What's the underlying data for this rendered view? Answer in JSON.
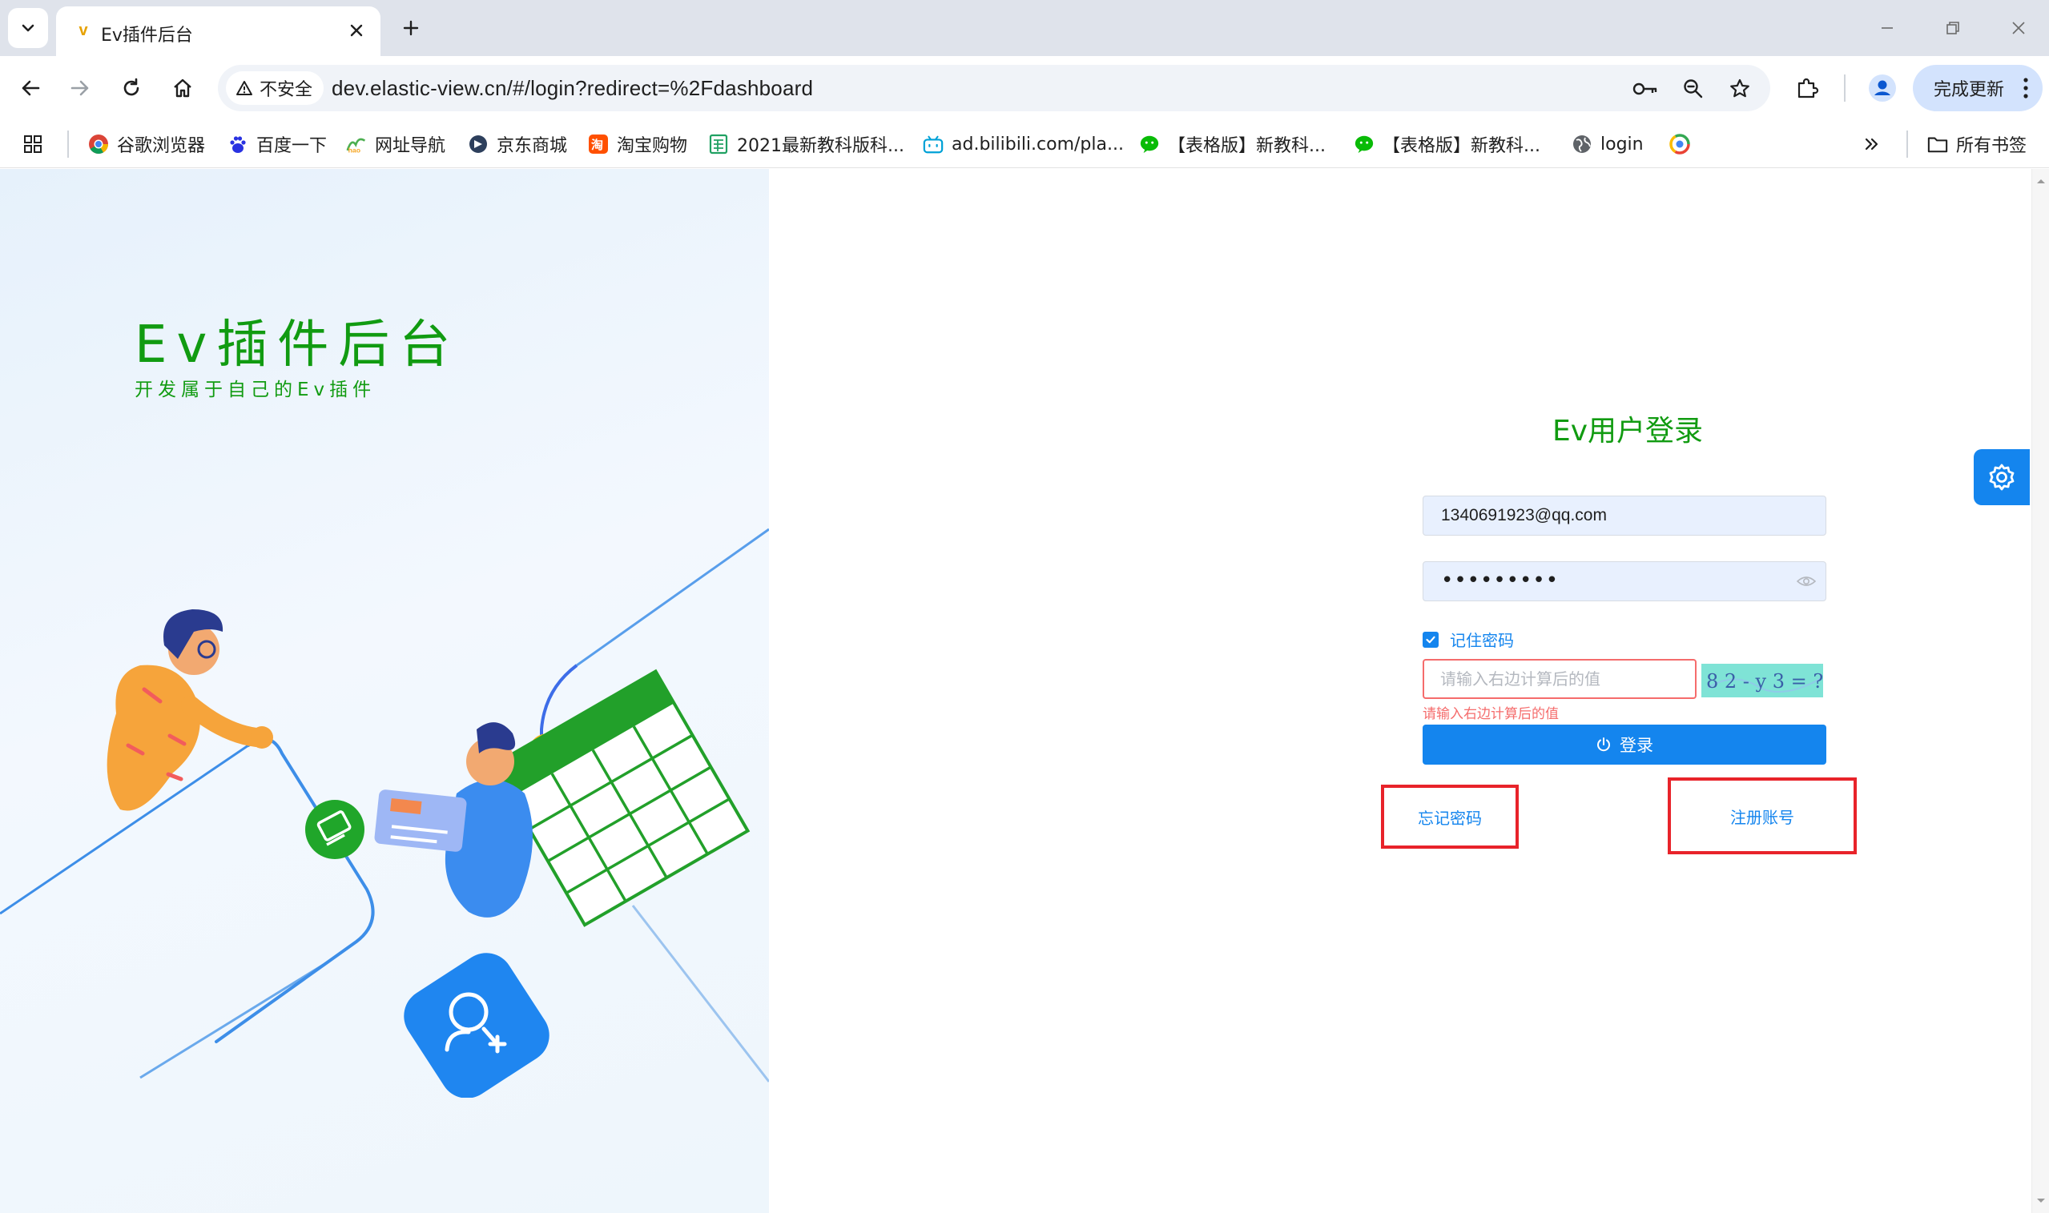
{
  "browser": {
    "tab_title": "Ev插件后台",
    "tab_favicon": "v",
    "not_secure_label": "不安全",
    "url": "dev.elastic-view.cn/#/login?redirect=%2Fdashboard",
    "update_button_label": "完成更新"
  },
  "bookmarks": {
    "items": [
      {
        "label": "谷歌浏览器",
        "icon": "chrome-icon"
      },
      {
        "label": "百度一下",
        "icon": "baidu-paw-icon"
      },
      {
        "label": "网址导航",
        "icon": "hao-icon"
      },
      {
        "label": "京东商城",
        "icon": "jd-icon"
      },
      {
        "label": "淘宝购物",
        "icon": "taobao-icon"
      },
      {
        "label": "2021最新教科版科...",
        "icon": "document-icon"
      },
      {
        "label": "ad.bilibili.com/pla...",
        "icon": "bilibili-icon"
      },
      {
        "label": "【表格版】新教科...",
        "icon": "wechat-icon"
      },
      {
        "label": "【表格版】新教科...",
        "icon": "wechat-icon"
      },
      {
        "label": "login",
        "icon": "globe-icon"
      }
    ],
    "all_bookmarks_label": "所有书签"
  },
  "hero": {
    "title": "Ev插件后台",
    "subtitle": "开发属于自己的Ev插件"
  },
  "login": {
    "title": "Ev用户登录",
    "username_value": "1340691923@qq.com",
    "password_mask": "•••••••••",
    "remember_label": "记住密码",
    "remember_checked": true,
    "captcha_placeholder": "请输入右边计算后的值",
    "captcha_image_text": "8 2 - y 3 = ?",
    "captcha_error": "请输入右边计算后的值",
    "login_button_label": "登录",
    "forgot_password_label": "忘记密码",
    "register_label": "注册账号"
  },
  "colors": {
    "brand_green": "#119b11",
    "primary_blue": "#1485ee",
    "error_red": "#f56c6c",
    "highlight_red": "#e8232a",
    "captcha_bg": "#7fe3d6"
  }
}
